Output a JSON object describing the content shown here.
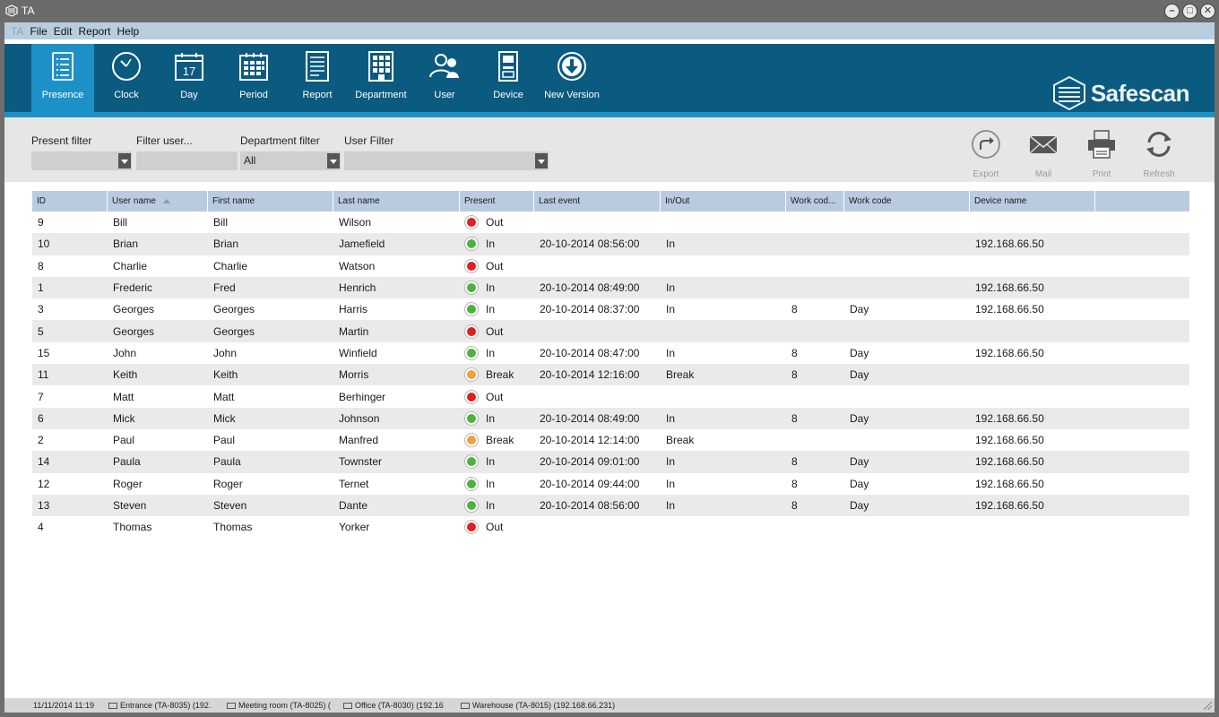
{
  "window": {
    "title": "TA"
  },
  "menu": [
    "TA",
    "File",
    "Edit",
    "Report",
    "Help"
  ],
  "toolbar": [
    {
      "label": "Presence",
      "icon": "presence-checklist-icon",
      "active": true
    },
    {
      "label": "Clock",
      "icon": "clock-icon"
    },
    {
      "label": "Day",
      "icon": "calendar-day-icon",
      "day_number": "17"
    },
    {
      "label": "Period",
      "icon": "calendar-period-icon"
    },
    {
      "label": "Report",
      "icon": "report-icon"
    },
    {
      "label": "Department",
      "icon": "department-grid-icon"
    },
    {
      "label": "User",
      "icon": "user-icon"
    },
    {
      "label": "Device",
      "icon": "device-icon"
    },
    {
      "label": "New Version",
      "icon": "download-icon"
    }
  ],
  "brand": {
    "name": "Safescan"
  },
  "filters": {
    "present_label": "Present filter",
    "present_value": "",
    "user_label": "Filter user...",
    "user_value": "",
    "department_label": "Department filter",
    "department_value": "All",
    "userfilter_label": "User Filter",
    "userfilter_value": ""
  },
  "actions": [
    {
      "label": "Export",
      "icon": "export-icon"
    },
    {
      "label": "Mail",
      "icon": "mail-icon"
    },
    {
      "label": "Print",
      "icon": "print-icon"
    },
    {
      "label": "Refresh",
      "icon": "refresh-icon"
    }
  ],
  "table": {
    "columns": [
      "ID",
      "User name",
      "First name",
      "Last name",
      "Present",
      "Last event",
      "In/Out",
      "Work cod...",
      "Work code",
      "Device name",
      ""
    ],
    "rows": [
      [
        "9",
        "Bill",
        "Bill",
        "Wilson",
        "Out",
        "",
        "",
        "",
        "",
        ""
      ],
      [
        "10",
        "Brian",
        "Brian",
        "Jamefield",
        "In",
        "20-10-2014 08:56:00",
        "In",
        "",
        "",
        "192.168.66.50"
      ],
      [
        "8",
        "Charlie",
        "Charlie",
        "Watson",
        "Out",
        "",
        "",
        "",
        "",
        ""
      ],
      [
        "1",
        "Frederic",
        "Fred",
        "Henrich",
        "In",
        "20-10-2014 08:49:00",
        "In",
        "",
        "",
        "192.168.66.50"
      ],
      [
        "3",
        "Georges",
        "Georges",
        "Harris",
        "In",
        "20-10-2014 08:37:00",
        "In",
        "8",
        "Day",
        "192.168.66.50"
      ],
      [
        "5",
        "Georges",
        "Georges",
        "Martin",
        "Out",
        "",
        "",
        "",
        "",
        ""
      ],
      [
        "15",
        "John",
        "John",
        "Winfield",
        "In",
        "20-10-2014 08:47:00",
        "In",
        "8",
        "Day",
        "192.168.66.50"
      ],
      [
        "11",
        "Keith",
        "Keith",
        "Morris",
        "Break",
        "20-10-2014 12:16:00",
        "Break",
        "8",
        "Day",
        ""
      ],
      [
        "7",
        "Matt",
        "Matt",
        "Berhinger",
        "Out",
        "",
        "",
        "",
        "",
        ""
      ],
      [
        "6",
        "Mick",
        "Mick",
        "Johnson",
        "In",
        "20-10-2014 08:49:00",
        "In",
        "8",
        "Day",
        "192.168.66.50"
      ],
      [
        "2",
        "Paul",
        "Paul",
        "Manfred",
        "Break",
        "20-10-2014 12:14:00",
        "Break",
        "",
        "",
        "192.168.66.50"
      ],
      [
        "14",
        "Paula",
        "Paula",
        "Townster",
        "In",
        "20-10-2014 09:01:00",
        "In",
        "8",
        "Day",
        "192.168.66.50"
      ],
      [
        "12",
        "Roger",
        "Roger",
        "Ternet",
        "In",
        "20-10-2014 09:44:00",
        "In",
        "8",
        "Day",
        "192.168.66.50"
      ],
      [
        "13",
        "Steven",
        "Steven",
        "Dante",
        "In",
        "20-10-2014 08:56:00",
        "In",
        "8",
        "Day",
        "192.168.66.50"
      ],
      [
        "4",
        "Thomas",
        "Thomas",
        "Yorker",
        "Out",
        "",
        "",
        "",
        "",
        ""
      ]
    ],
    "status_colors": {
      "In": "#4db33d",
      "Out": "#e02020",
      "Break": "#f0a040"
    }
  },
  "statusbar": {
    "datetime": "11/11/2014 11:19",
    "devices": [
      "Entrance (TA-8035) (192.",
      "Meeting room (TA-8025) (",
      "Office (TA-8030) (192.16",
      "Warehouse (TA-8015) (192.168.66.231)"
    ]
  },
  "colors": {
    "toolbar_bg": "#0b5a80",
    "accent": "#1e90c8",
    "menubar": "#b9cde0",
    "header": "#b8cbe0"
  }
}
